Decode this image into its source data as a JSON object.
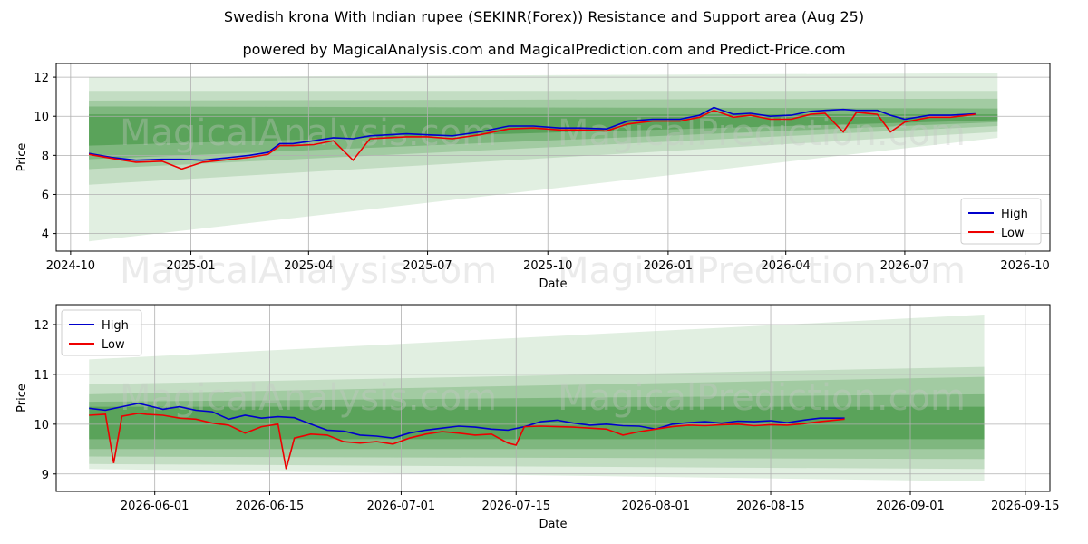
{
  "title": "Swedish krona With Indian rupee (SEKINR(Forex)) Resistance and Support area (Aug 25)",
  "subtitle": "powered by MagicalAnalysis.com and MagicalPrediction.com and Predict-Price.com",
  "watermarks": [
    "MagicalAnalysis.com",
    "MagicalPrediction.com"
  ],
  "colors": {
    "high": "#0000cc",
    "low": "#ee0000",
    "band": "#2e8b2e",
    "grid": "#b0b0b0"
  },
  "chart_data": [
    {
      "type": "line",
      "xlabel": "Date",
      "ylabel": "Price",
      "x_ticks": [
        "2024-10",
        "2025-01",
        "2025-04",
        "2025-07",
        "2025-10",
        "2026-01",
        "2026-04",
        "2026-07",
        "2026-10"
      ],
      "y_ticks": [
        4,
        6,
        8,
        10,
        12
      ],
      "xlim": [
        "2024-09-20",
        "2026-10-20"
      ],
      "ylim": [
        3.1,
        12.7
      ],
      "legend": {
        "position": "lower-right",
        "entries": [
          "High",
          "Low"
        ]
      },
      "grid": true,
      "bands": {
        "x": [
          "2024-10-15",
          "2026-09-10"
        ],
        "upper": [
          [
            12.0,
            12.2
          ],
          [
            11.3,
            11.3
          ],
          [
            10.8,
            10.9
          ],
          [
            10.5,
            10.4
          ],
          [
            10.1,
            10.1
          ]
        ],
        "lower": [
          [
            3.6,
            8.9
          ],
          [
            6.5,
            9.2
          ],
          [
            7.3,
            9.5
          ],
          [
            7.8,
            9.7
          ],
          [
            8.5,
            9.8
          ]
        ]
      },
      "series": [
        {
          "name": "High",
          "x": [
            "2024-10-15",
            "2024-11-01",
            "2024-11-20",
            "2024-12-10",
            "2024-12-25",
            "2025-01-10",
            "2025-01-25",
            "2025-02-15",
            "2025-03-01",
            "2025-03-10",
            "2025-03-20",
            "2025-04-05",
            "2025-04-20",
            "2025-05-05",
            "2025-05-18",
            "2025-06-01",
            "2025-06-15",
            "2025-07-01",
            "2025-07-20",
            "2025-08-10",
            "2025-09-01",
            "2025-09-20",
            "2025-10-10",
            "2025-10-25",
            "2025-11-15",
            "2025-12-01",
            "2025-12-20",
            "2026-01-10",
            "2026-01-25",
            "2026-02-05",
            "2026-02-20",
            "2026-03-05",
            "2026-03-20",
            "2026-04-05",
            "2026-04-20",
            "2026-05-01",
            "2026-05-15",
            "2026-05-25",
            "2026-06-10",
            "2026-06-20",
            "2026-07-01",
            "2026-07-20",
            "2026-08-05",
            "2026-08-24"
          ],
          "values": [
            8.1,
            7.9,
            7.75,
            7.8,
            7.8,
            7.75,
            7.85,
            8.0,
            8.15,
            8.6,
            8.6,
            8.75,
            8.9,
            8.85,
            9.0,
            9.05,
            9.1,
            9.05,
            9.0,
            9.2,
            9.5,
            9.5,
            9.4,
            9.4,
            9.35,
            9.75,
            9.85,
            9.85,
            10.05,
            10.45,
            10.1,
            10.15,
            10.0,
            10.05,
            10.25,
            10.3,
            10.35,
            10.3,
            10.3,
            10.05,
            9.85,
            10.05,
            10.05,
            10.12
          ]
        },
        {
          "name": "Low",
          "x": [
            "2024-10-15",
            "2024-11-01",
            "2024-11-20",
            "2024-12-10",
            "2024-12-25",
            "2025-01-10",
            "2025-01-25",
            "2025-02-15",
            "2025-03-01",
            "2025-03-10",
            "2025-03-20",
            "2025-04-05",
            "2025-04-20",
            "2025-05-05",
            "2025-05-18",
            "2025-06-01",
            "2025-06-15",
            "2025-07-01",
            "2025-07-20",
            "2025-08-10",
            "2025-09-01",
            "2025-09-20",
            "2025-10-10",
            "2025-10-25",
            "2025-11-15",
            "2025-12-01",
            "2025-12-20",
            "2026-01-10",
            "2026-01-25",
            "2026-02-05",
            "2026-02-20",
            "2026-03-05",
            "2026-03-20",
            "2026-04-05",
            "2026-04-20",
            "2026-05-01",
            "2026-05-15",
            "2026-05-25",
            "2026-06-10",
            "2026-06-20",
            "2026-07-01",
            "2026-07-20",
            "2026-08-05",
            "2026-08-24"
          ],
          "values": [
            8.05,
            7.85,
            7.65,
            7.7,
            7.3,
            7.65,
            7.75,
            7.9,
            8.05,
            8.5,
            8.5,
            8.55,
            8.75,
            7.75,
            8.85,
            8.9,
            8.95,
            8.95,
            8.85,
            9.05,
            9.35,
            9.4,
            9.3,
            9.3,
            9.25,
            9.6,
            9.75,
            9.75,
            9.95,
            10.3,
            9.95,
            10.05,
            9.85,
            9.85,
            10.1,
            10.15,
            9.2,
            10.2,
            10.1,
            9.2,
            9.7,
            9.95,
            9.95,
            10.1
          ]
        }
      ]
    },
    {
      "type": "line",
      "xlabel": "Date",
      "ylabel": "Price",
      "x_ticks": [
        "2026-06-01",
        "2026-06-15",
        "2026-07-01",
        "2026-07-15",
        "2026-08-01",
        "2026-08-15",
        "2026-09-01",
        "2026-09-15"
      ],
      "y_ticks": [
        9,
        10,
        11,
        12
      ],
      "xlim": [
        "2026-05-20",
        "2026-09-18"
      ],
      "ylim": [
        8.65,
        12.4
      ],
      "legend": {
        "position": "upper-left",
        "entries": [
          "High",
          "Low"
        ]
      },
      "grid": true,
      "bands": {
        "x": [
          "2026-05-24",
          "2026-09-10"
        ],
        "upper": [
          [
            11.3,
            12.2
          ],
          [
            10.8,
            11.15
          ],
          [
            10.6,
            10.95
          ],
          [
            10.45,
            10.6
          ],
          [
            10.35,
            10.35
          ]
        ],
        "lower": [
          [
            9.1,
            8.85
          ],
          [
            9.2,
            9.1
          ],
          [
            9.35,
            9.3
          ],
          [
            9.5,
            9.5
          ],
          [
            9.7,
            9.7
          ]
        ]
      },
      "series": [
        {
          "name": "High",
          "x": [
            "2026-05-24",
            "2026-05-26",
            "2026-05-28",
            "2026-05-30",
            "2026-05-31",
            "2026-06-02",
            "2026-06-04",
            "2026-06-06",
            "2026-06-08",
            "2026-06-10",
            "2026-06-12",
            "2026-06-14",
            "2026-06-16",
            "2026-06-18",
            "2026-06-20",
            "2026-06-22",
            "2026-06-24",
            "2026-06-26",
            "2026-06-28",
            "2026-06-30",
            "2026-07-02",
            "2026-07-04",
            "2026-07-06",
            "2026-07-08",
            "2026-07-10",
            "2026-07-12",
            "2026-07-14",
            "2026-07-16",
            "2026-07-18",
            "2026-07-20",
            "2026-07-22",
            "2026-07-24",
            "2026-07-26",
            "2026-07-28",
            "2026-07-30",
            "2026-08-01",
            "2026-08-03",
            "2026-08-05",
            "2026-08-07",
            "2026-08-09",
            "2026-08-11",
            "2026-08-13",
            "2026-08-15",
            "2026-08-17",
            "2026-08-19",
            "2026-08-21",
            "2026-08-24"
          ],
          "values": [
            10.32,
            10.28,
            10.35,
            10.42,
            10.38,
            10.3,
            10.35,
            10.28,
            10.25,
            10.1,
            10.18,
            10.12,
            10.15,
            10.13,
            10.0,
            9.88,
            9.86,
            9.78,
            9.76,
            9.72,
            9.82,
            9.88,
            9.92,
            9.96,
            9.94,
            9.9,
            9.88,
            9.95,
            10.05,
            10.08,
            10.02,
            9.98,
            10.0,
            9.97,
            9.96,
            9.9,
            10.0,
            10.03,
            10.05,
            10.02,
            10.06,
            10.05,
            10.07,
            10.03,
            10.08,
            10.12,
            10.12
          ]
        },
        {
          "name": "Low",
          "x": [
            "2026-05-24",
            "2026-05-26",
            "2026-05-27",
            "2026-05-28",
            "2026-05-30",
            "2026-05-31",
            "2026-06-02",
            "2026-06-04",
            "2026-06-06",
            "2026-06-08",
            "2026-06-10",
            "2026-06-12",
            "2026-06-14",
            "2026-06-16",
            "2026-06-17",
            "2026-06-18",
            "2026-06-20",
            "2026-06-22",
            "2026-06-24",
            "2026-06-26",
            "2026-06-28",
            "2026-06-30",
            "2026-07-02",
            "2026-07-04",
            "2026-07-06",
            "2026-07-08",
            "2026-07-10",
            "2026-07-12",
            "2026-07-14",
            "2026-07-15",
            "2026-07-16",
            "2026-07-18",
            "2026-07-20",
            "2026-07-22",
            "2026-07-24",
            "2026-07-26",
            "2026-07-28",
            "2026-07-30",
            "2026-08-01",
            "2026-08-03",
            "2026-08-05",
            "2026-08-07",
            "2026-08-09",
            "2026-08-11",
            "2026-08-13",
            "2026-08-15",
            "2026-08-17",
            "2026-08-19",
            "2026-08-21",
            "2026-08-24"
          ],
          "values": [
            10.18,
            10.2,
            9.22,
            10.16,
            10.22,
            10.2,
            10.18,
            10.12,
            10.1,
            10.02,
            9.98,
            9.82,
            9.95,
            10.0,
            9.1,
            9.72,
            9.8,
            9.78,
            9.65,
            9.62,
            9.65,
            9.6,
            9.72,
            9.8,
            9.85,
            9.82,
            9.78,
            9.8,
            9.62,
            9.58,
            9.95,
            9.96,
            9.95,
            9.94,
            9.92,
            9.9,
            9.78,
            9.85,
            9.9,
            9.95,
            9.98,
            9.97,
            9.99,
            10.0,
            9.97,
            9.99,
            9.98,
            10.01,
            10.05,
            10.1
          ]
        }
      ]
    }
  ]
}
